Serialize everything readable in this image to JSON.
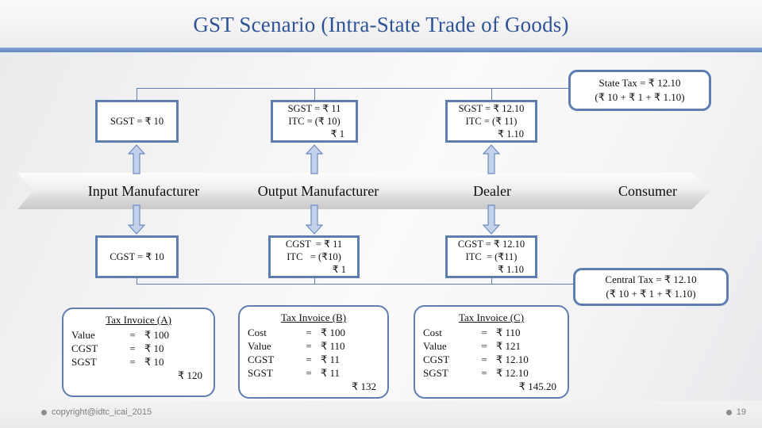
{
  "slide": {
    "title": "GST Scenario (Intra-State Trade of Goods)",
    "accent_color": "#7193c8",
    "title_color": "#2e5395",
    "box_border_color": "#5f7eb0",
    "arrow_fill_color": "#c3d2ea"
  },
  "summary_boxes": {
    "state_tax": {
      "line1": "State Tax = ₹ 12.10",
      "line2": "(₹ 10 + ₹ 1 + ₹ 1.10)"
    },
    "central_tax": {
      "line1": "Central Tax = ₹ 12.10",
      "line2": "(₹ 10 + ₹ 1 + ₹ 1.10)"
    }
  },
  "sgst_boxes": [
    {
      "line1": "SGST = ₹ 10",
      "line2": "",
      "line3": ""
    },
    {
      "line1": "SGST = ₹ 11",
      "line2": "ITC = (₹ 10)",
      "line3": "₹ 1"
    },
    {
      "line1": "SGST = ₹ 12.10",
      "line2": "ITC = (₹ 11)",
      "line3": "₹ 1.10"
    }
  ],
  "cgst_boxes": [
    {
      "line1": "CGST = ₹ 10",
      "line2": "",
      "line3": ""
    },
    {
      "line1": "CGST  = ₹ 11",
      "line2": "ITC   = (₹10)",
      "line3": "₹ 1"
    },
    {
      "line1": "CGST = ₹ 12.10",
      "line2": "ITC  = (₹11)",
      "line3": "₹ 1.10"
    }
  ],
  "process_band": {
    "stages": [
      {
        "label": "Input Manufacturer"
      },
      {
        "label": "Output Manufacturer"
      },
      {
        "label": "Dealer"
      },
      {
        "label": "Consumer"
      }
    ]
  },
  "invoices": [
    {
      "title": "Tax Invoice (A)",
      "rows": [
        {
          "label": "Value",
          "eq": "=",
          "value": "₹ 100"
        },
        {
          "label": "CGST",
          "eq": "=",
          "value": "₹ 10"
        },
        {
          "label": "SGST",
          "eq": "=",
          "value": "₹ 10"
        }
      ],
      "total": "₹ 120"
    },
    {
      "title": "Tax Invoice (B)",
      "rows": [
        {
          "label": "Cost",
          "eq": "=",
          "value": "₹ 100"
        },
        {
          "label": "Value",
          "eq": "=",
          "value": "₹ 110"
        },
        {
          "label": "CGST",
          "eq": "=",
          "value": "₹ 11"
        },
        {
          "label": "SGST",
          "eq": "=",
          "value": "₹ 11"
        }
      ],
      "total": "₹ 132"
    },
    {
      "title": "Tax Invoice (C)",
      "rows": [
        {
          "label": "Cost",
          "eq": "=",
          "value": "₹ 110"
        },
        {
          "label": "Value",
          "eq": "=",
          "value": "₹ 121"
        },
        {
          "label": "CGST",
          "eq": "=",
          "value": "₹ 12.10"
        },
        {
          "label": "SGST",
          "eq": "=",
          "value": "₹ 12.10"
        }
      ],
      "total": "₹ 145.20"
    }
  ],
  "footer": {
    "copyright": "copyright@idtc_icai_2015",
    "page_number": "19"
  }
}
